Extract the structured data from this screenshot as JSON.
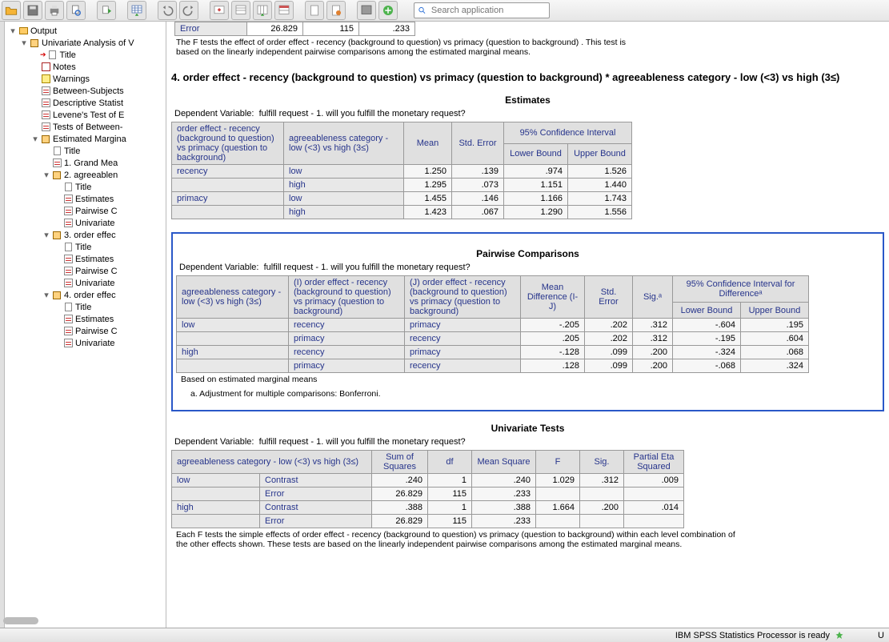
{
  "search": {
    "placeholder": "Search application"
  },
  "tree": {
    "root": "Output",
    "n_uni": "Univariate Analysis of V",
    "n_title": "Title",
    "n_notes": "Notes",
    "n_warn": "Warnings",
    "n_bsf": "Between-Subjects",
    "n_desc": "Descriptive Statist",
    "n_lev": "Levene's Test of E",
    "n_tobs": "Tests of Between-",
    "n_emm": "Estimated Margina",
    "n_t2": "Title",
    "n_gm": "1. Grand Mea",
    "n_agr": "2. agreeablen",
    "n_t3": "Title",
    "n_est": "Estimates",
    "n_pw": "Pairwise C",
    "n_uvt": "Univariate",
    "n_ord": "3. order effec",
    "n_t4": "Title",
    "n_est4": "Estimates",
    "n_pw4": "Pairwise C",
    "n_uvt4": "Univariate",
    "n_oe4": "4. order effec",
    "n_t5": "Title",
    "n_est5": "Estimates",
    "n_pw5": "Pairwise C",
    "n_uvt5": "Univariate"
  },
  "frag": {
    "c1": "Error",
    "c2": "26.829",
    "c3": "115",
    "c4": ".233",
    "note": "The F tests the effect of order effect - recency (background to question) vs primacy (question to background) . This test is based on the linearly independent pairwise comparisons among the estimated marginal means."
  },
  "section4_title": "4. order effect - recency (background to question) vs primacy (question to background)  * agreeableness category - low (<3) vs high (3≤)",
  "depvar_label": "Dependent Variable:",
  "depvar_value": "fulfill request - 1. will you fulfill the monetary request?",
  "estimates": {
    "title": "Estimates",
    "h_order": "order effect - recency (background to question) vs primacy (question to background)",
    "h_agree": "agreeableness category - low (<3) vs high (3≤)",
    "h_mean": "Mean",
    "h_se": "Std. Error",
    "h_ci": "95% Confidence Interval",
    "h_lb": "Lower Bound",
    "h_ub": "Upper Bound",
    "rows": [
      {
        "o": "recency",
        "a": "low",
        "m": "1.250",
        "se": ".139",
        "lb": ".974",
        "ub": "1.526"
      },
      {
        "o": "",
        "a": "high",
        "m": "1.295",
        "se": ".073",
        "lb": "1.151",
        "ub": "1.440"
      },
      {
        "o": "primacy",
        "a": "low",
        "m": "1.455",
        "se": ".146",
        "lb": "1.166",
        "ub": "1.743"
      },
      {
        "o": "",
        "a": "high",
        "m": "1.423",
        "se": ".067",
        "lb": "1.290",
        "ub": "1.556"
      }
    ]
  },
  "pairwise": {
    "title": "Pairwise Comparisons",
    "h_agree": "agreeableness category - low (<3) vs high (3≤)",
    "h_i": "(I) order effect - recency (background to question) vs primacy (question to background)",
    "h_j": "(J) order effect - recency (background to question) vs primacy (question to background)",
    "h_md": "Mean Difference (I-J)",
    "h_se": "Std. Error",
    "h_sig": "Sig.ᵃ",
    "h_ci": "95% Confidence Interval for Differenceᵃ",
    "h_lb": "Lower Bound",
    "h_ub": "Upper Bound",
    "rows": [
      {
        "g": "low",
        "i": "recency",
        "j": "primacy",
        "md": "-.205",
        "se": ".202",
        "sig": ".312",
        "lb": "-.604",
        "ub": ".195"
      },
      {
        "g": "",
        "i": "primacy",
        "j": "recency",
        "md": ".205",
        "se": ".202",
        "sig": ".312",
        "lb": "-.195",
        "ub": ".604"
      },
      {
        "g": "high",
        "i": "recency",
        "j": "primacy",
        "md": "-.128",
        "se": ".099",
        "sig": ".200",
        "lb": "-.324",
        "ub": ".068"
      },
      {
        "g": "",
        "i": "primacy",
        "j": "recency",
        "md": ".128",
        "se": ".099",
        "sig": ".200",
        "lb": "-.068",
        "ub": ".324"
      }
    ],
    "foot1": "Based on estimated marginal means",
    "foot2": "a. Adjustment for multiple comparisons: Bonferroni."
  },
  "univ": {
    "title": "Univariate Tests",
    "h_agree": "agreeableness category - low (<3) vs high (3≤)",
    "h_ss": "Sum of Squares",
    "h_df": "df",
    "h_ms": "Mean Square",
    "h_f": "F",
    "h_sig": "Sig.",
    "h_pes": "Partial Eta Squared",
    "rows": [
      {
        "g": "low",
        "t": "Contrast",
        "ss": ".240",
        "df": "1",
        "ms": ".240",
        "f": "1.029",
        "sig": ".312",
        "pes": ".009"
      },
      {
        "g": "",
        "t": "Error",
        "ss": "26.829",
        "df": "115",
        "ms": ".233",
        "f": "",
        "sig": "",
        "pes": ""
      },
      {
        "g": "high",
        "t": "Contrast",
        "ss": ".388",
        "df": "1",
        "ms": ".388",
        "f": "1.664",
        "sig": ".200",
        "pes": ".014"
      },
      {
        "g": "",
        "t": "Error",
        "ss": "26.829",
        "df": "115",
        "ms": ".233",
        "f": "",
        "sig": "",
        "pes": ""
      }
    ],
    "foot": "Each F tests the simple effects of order effect - recency (background to question) vs primacy (question to background)  within each level combination of the other effects shown. These tests are based on the linearly independent pairwise comparisons among the estimated marginal means."
  },
  "status": {
    "text": "IBM SPSS Statistics Processor is ready",
    "tail": "U"
  }
}
